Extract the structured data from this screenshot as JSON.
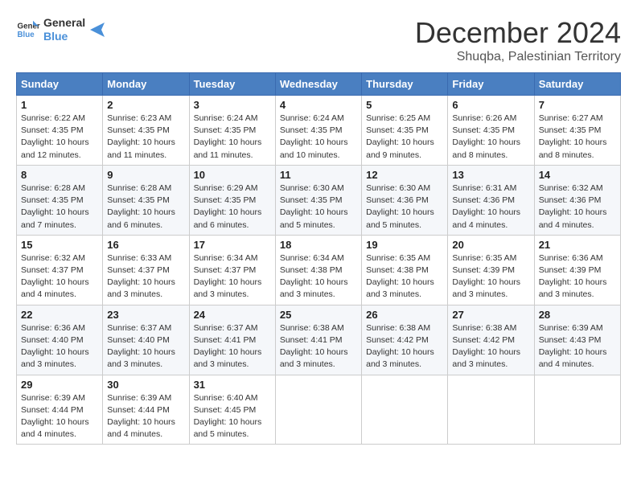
{
  "logo": {
    "line1": "General",
    "line2": "Blue"
  },
  "title": "December 2024",
  "location": "Shuqba, Palestinian Territory",
  "days_of_week": [
    "Sunday",
    "Monday",
    "Tuesday",
    "Wednesday",
    "Thursday",
    "Friday",
    "Saturday"
  ],
  "weeks": [
    [
      {
        "day": "1",
        "sunrise": "6:22 AM",
        "sunset": "4:35 PM",
        "daylight": "10 hours and 12 minutes."
      },
      {
        "day": "2",
        "sunrise": "6:23 AM",
        "sunset": "4:35 PM",
        "daylight": "10 hours and 11 minutes."
      },
      {
        "day": "3",
        "sunrise": "6:24 AM",
        "sunset": "4:35 PM",
        "daylight": "10 hours and 11 minutes."
      },
      {
        "day": "4",
        "sunrise": "6:24 AM",
        "sunset": "4:35 PM",
        "daylight": "10 hours and 10 minutes."
      },
      {
        "day": "5",
        "sunrise": "6:25 AM",
        "sunset": "4:35 PM",
        "daylight": "10 hours and 9 minutes."
      },
      {
        "day": "6",
        "sunrise": "6:26 AM",
        "sunset": "4:35 PM",
        "daylight": "10 hours and 8 minutes."
      },
      {
        "day": "7",
        "sunrise": "6:27 AM",
        "sunset": "4:35 PM",
        "daylight": "10 hours and 8 minutes."
      }
    ],
    [
      {
        "day": "8",
        "sunrise": "6:28 AM",
        "sunset": "4:35 PM",
        "daylight": "10 hours and 7 minutes."
      },
      {
        "day": "9",
        "sunrise": "6:28 AM",
        "sunset": "4:35 PM",
        "daylight": "10 hours and 6 minutes."
      },
      {
        "day": "10",
        "sunrise": "6:29 AM",
        "sunset": "4:35 PM",
        "daylight": "10 hours and 6 minutes."
      },
      {
        "day": "11",
        "sunrise": "6:30 AM",
        "sunset": "4:35 PM",
        "daylight": "10 hours and 5 minutes."
      },
      {
        "day": "12",
        "sunrise": "6:30 AM",
        "sunset": "4:36 PM",
        "daylight": "10 hours and 5 minutes."
      },
      {
        "day": "13",
        "sunrise": "6:31 AM",
        "sunset": "4:36 PM",
        "daylight": "10 hours and 4 minutes."
      },
      {
        "day": "14",
        "sunrise": "6:32 AM",
        "sunset": "4:36 PM",
        "daylight": "10 hours and 4 minutes."
      }
    ],
    [
      {
        "day": "15",
        "sunrise": "6:32 AM",
        "sunset": "4:37 PM",
        "daylight": "10 hours and 4 minutes."
      },
      {
        "day": "16",
        "sunrise": "6:33 AM",
        "sunset": "4:37 PM",
        "daylight": "10 hours and 3 minutes."
      },
      {
        "day": "17",
        "sunrise": "6:34 AM",
        "sunset": "4:37 PM",
        "daylight": "10 hours and 3 minutes."
      },
      {
        "day": "18",
        "sunrise": "6:34 AM",
        "sunset": "4:38 PM",
        "daylight": "10 hours and 3 minutes."
      },
      {
        "day": "19",
        "sunrise": "6:35 AM",
        "sunset": "4:38 PM",
        "daylight": "10 hours and 3 minutes."
      },
      {
        "day": "20",
        "sunrise": "6:35 AM",
        "sunset": "4:39 PM",
        "daylight": "10 hours and 3 minutes."
      },
      {
        "day": "21",
        "sunrise": "6:36 AM",
        "sunset": "4:39 PM",
        "daylight": "10 hours and 3 minutes."
      }
    ],
    [
      {
        "day": "22",
        "sunrise": "6:36 AM",
        "sunset": "4:40 PM",
        "daylight": "10 hours and 3 minutes."
      },
      {
        "day": "23",
        "sunrise": "6:37 AM",
        "sunset": "4:40 PM",
        "daylight": "10 hours and 3 minutes."
      },
      {
        "day": "24",
        "sunrise": "6:37 AM",
        "sunset": "4:41 PM",
        "daylight": "10 hours and 3 minutes."
      },
      {
        "day": "25",
        "sunrise": "6:38 AM",
        "sunset": "4:41 PM",
        "daylight": "10 hours and 3 minutes."
      },
      {
        "day": "26",
        "sunrise": "6:38 AM",
        "sunset": "4:42 PM",
        "daylight": "10 hours and 3 minutes."
      },
      {
        "day": "27",
        "sunrise": "6:38 AM",
        "sunset": "4:42 PM",
        "daylight": "10 hours and 3 minutes."
      },
      {
        "day": "28",
        "sunrise": "6:39 AM",
        "sunset": "4:43 PM",
        "daylight": "10 hours and 4 minutes."
      }
    ],
    [
      {
        "day": "29",
        "sunrise": "6:39 AM",
        "sunset": "4:44 PM",
        "daylight": "10 hours and 4 minutes."
      },
      {
        "day": "30",
        "sunrise": "6:39 AM",
        "sunset": "4:44 PM",
        "daylight": "10 hours and 4 minutes."
      },
      {
        "day": "31",
        "sunrise": "6:40 AM",
        "sunset": "4:45 PM",
        "daylight": "10 hours and 5 minutes."
      },
      null,
      null,
      null,
      null
    ]
  ],
  "labels": {
    "sunrise": "Sunrise:",
    "sunset": "Sunset:",
    "daylight": "Daylight:"
  }
}
